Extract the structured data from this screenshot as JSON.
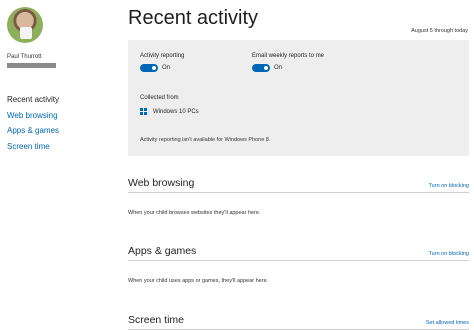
{
  "user": {
    "name": "Paul Thurrott"
  },
  "sidebar": {
    "items": [
      {
        "label": "Recent activity",
        "active": true
      },
      {
        "label": "Web browsing",
        "active": false
      },
      {
        "label": "Apps & games",
        "active": false
      },
      {
        "label": "Screen time",
        "active": false
      }
    ]
  },
  "main": {
    "title": "Recent activity",
    "date_range": "August 5 through today",
    "summary": {
      "activity_reporting": {
        "label": "Activity reporting",
        "state": "On"
      },
      "email_reports": {
        "label": "Email weekly reports to me",
        "state": "On"
      },
      "collected_from_label": "Collected from",
      "device_label": "Windows 10 PCs",
      "note": "Activity reporting isn't available for Windows Phone 8."
    },
    "sections": [
      {
        "title": "Web browsing",
        "link": "Turn on blocking",
        "desc": "When your child browses websites they'll appear here."
      },
      {
        "title": "Apps & games",
        "link": "Turn on blocking",
        "desc": "When your child uses apps or games, they'll appear here."
      },
      {
        "title": "Screen time",
        "link": "Set allowed times",
        "desc": ""
      }
    ]
  },
  "colors": {
    "accent": "#0067b8",
    "panel_bg": "#eeeeee"
  },
  "icons": {
    "device": "windows-logo-icon"
  }
}
